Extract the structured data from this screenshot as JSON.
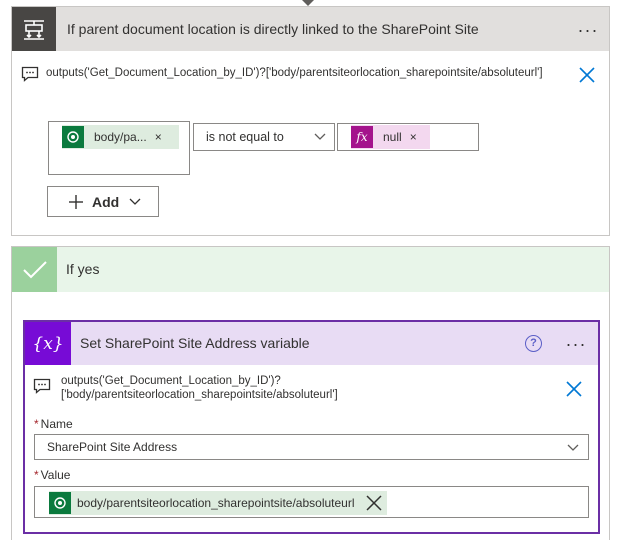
{
  "condition": {
    "title": "If parent document location is directly linked to the SharePoint Site",
    "more_label": "···",
    "comment": "outputs('Get_Document_Location_by_ID')?['body/parentsiteorlocation_sharepointsite/absoluteurl']",
    "left_operand": {
      "label": "body/pa...",
      "close": "×"
    },
    "operator": "is not equal to",
    "right_operand": {
      "label": "null",
      "close": "×"
    },
    "add_label": "Add"
  },
  "yes_branch": {
    "title": "If yes"
  },
  "set_variable": {
    "icon_text": "{x}",
    "title": "Set SharePoint Site Address variable",
    "help": "?",
    "more_label": "···",
    "comment_line1": "outputs('Get_Document_Location_by_ID')?",
    "comment_line2": "['body/parentsiteorlocation_sharepointsite/absoluteurl']",
    "name_label": "Name",
    "name_value": "SharePoint Site Address",
    "value_label": "Value",
    "value_token": "body/parentsiteorlocation_sharepointsite/absoluteurl",
    "required_mark": "*"
  },
  "icons": {
    "condition": "condition-icon",
    "comment": "comment-icon",
    "close": "close-icon",
    "dataverse": "dataverse-icon",
    "expression": "fx-icon",
    "chevron": "chevron-down-icon",
    "plus": "plus-icon",
    "check": "checkmark-icon",
    "help": "help-icon"
  },
  "colors": {
    "condition_header": "#e1dfdd",
    "condition_icon_bg": "#484644",
    "yes_header": "#e8f5e9",
    "yes_icon_bg": "#9bd19d",
    "variable_border": "#6b2fa5",
    "variable_header": "#e8dcf4",
    "variable_icon_bg": "#770bd6",
    "dataverse_token": "#deecdf",
    "expression_token": "#f3d8ef",
    "accent_blue": "#0078d4"
  }
}
